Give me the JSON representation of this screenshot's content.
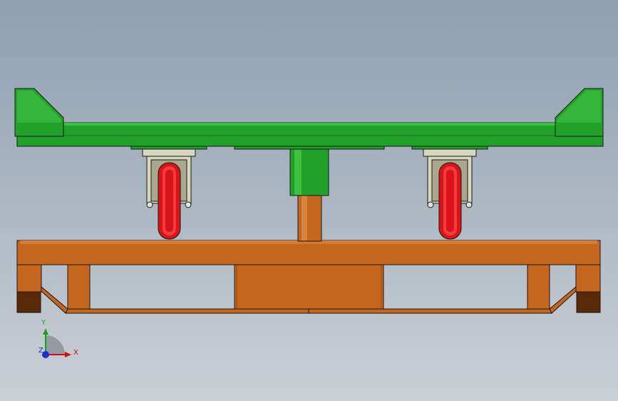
{
  "scene": {
    "colors": {
      "frame_green": "#22a12a",
      "frame_green_dark": "#167a1c",
      "frame_green_light": "#3cc23f",
      "base_orange": "#c5661f",
      "base_orange_dark": "#8a4410",
      "base_foot_dark": "#5a2a08",
      "wheel_red": "#d8141b",
      "wheel_red_light": "#ff4a4a",
      "caster_bracket": "#d7d6bf",
      "outline": "#1a1a1a"
    }
  },
  "triad": {
    "x_label": "X",
    "y_label": "Y",
    "z_label": "Z",
    "x_color": "#d01010",
    "y_color": "#19a019",
    "z_color": "#1a2fd0"
  }
}
